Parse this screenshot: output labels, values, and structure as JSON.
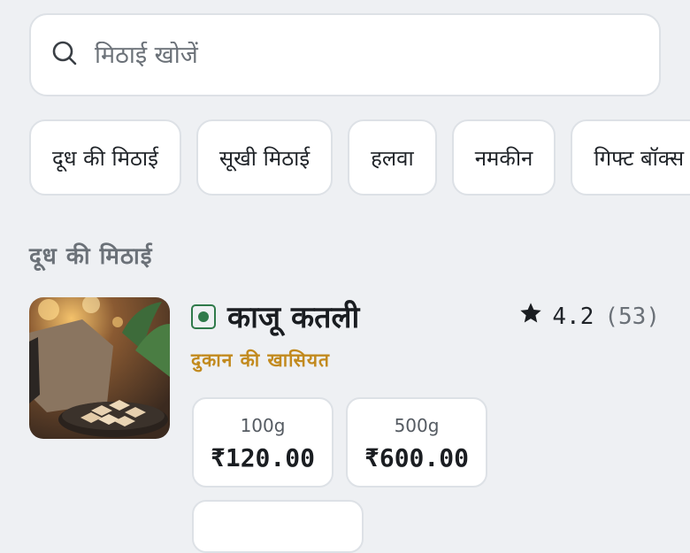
{
  "search": {
    "placeholder": "मिठाई खोजें",
    "icon": "search-icon"
  },
  "categories": [
    {
      "label": "दूध की मिठाई"
    },
    {
      "label": "सूखी मिठाई"
    },
    {
      "label": "हलवा"
    },
    {
      "label": "नमकीन"
    },
    {
      "label": "गिफ्ट बॉक्स"
    }
  ],
  "section": {
    "title": "दूध की मिठाई"
  },
  "item": {
    "name": "काजू कतली",
    "veg_indicator": "veg-icon",
    "tagline": "दुकान की खासियत",
    "rating": "4.2",
    "rating_count": "(53)",
    "variants": [
      {
        "size": "100g",
        "price": "₹120.00"
      },
      {
        "size": "500g",
        "price": "₹600.00"
      }
    ]
  },
  "colors": {
    "background": "#eef0f3",
    "veg_green": "#2f7a4a",
    "tagline_gold": "#c28a1e",
    "muted_text": "#6b7178"
  }
}
